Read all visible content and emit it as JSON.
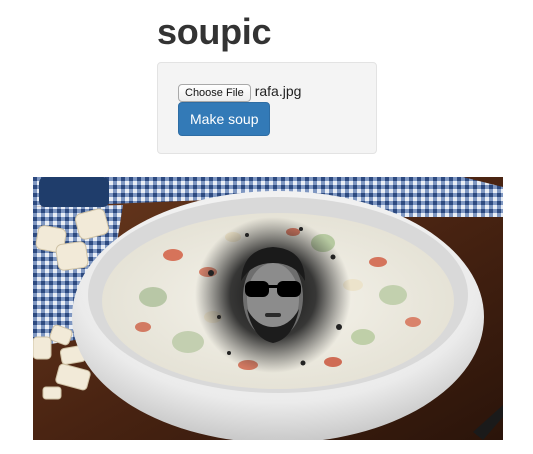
{
  "header": {
    "title": "soupic"
  },
  "upload": {
    "choose_file_label": "Choose File",
    "file_name": "rafa.jpg",
    "submit_label": "Make soup"
  },
  "result": {
    "image_description_icon": "soup-bowl-with-face-image"
  },
  "colors": {
    "primary_button": "#337ab7",
    "panel_background": "#f4f4f4",
    "title_text": "#333333"
  }
}
